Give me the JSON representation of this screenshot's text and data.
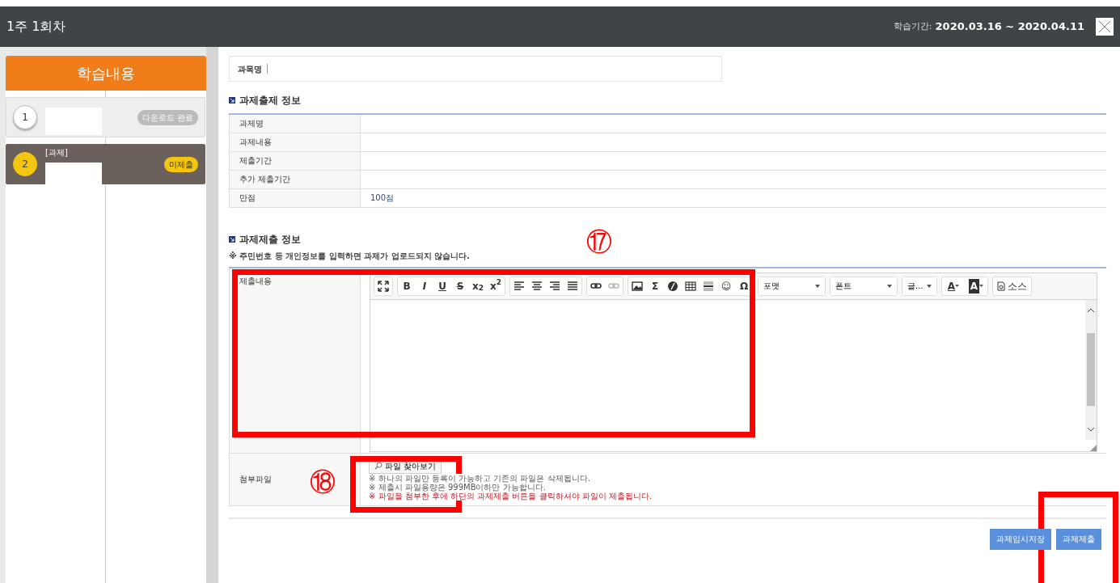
{
  "window": {
    "title": "1주 1회차",
    "period_label": "학습기간:",
    "period": "2020.03.16 ~ 2020.04.11"
  },
  "sidebar": {
    "title": "학습내용",
    "lessons": [
      {
        "number": "1",
        "status": "다운로드 완료",
        "kind": "done",
        "selected": false
      },
      {
        "number": "2",
        "title": "[과제]",
        "status": "미제출",
        "kind": "pending",
        "selected": true
      }
    ]
  },
  "course": {
    "label": "과목명"
  },
  "assignment_info": {
    "heading": "과제출제 정보",
    "rows": [
      {
        "label": "과제명",
        "value": ""
      },
      {
        "label": "과제내용",
        "value": ""
      },
      {
        "label": "제출기간",
        "value": ""
      },
      {
        "label": "추가 제출기간",
        "value": ""
      },
      {
        "label": "만점",
        "value": "100점"
      }
    ]
  },
  "submission": {
    "heading": "과제제출 정보",
    "note": "※ 주민번호 등 개인정보를 입력하면 과제가 업로드되지 않습니다.",
    "content_label": "제출내용",
    "toolbar": [
      [
        {
          "kind": "maximize"
        }
      ],
      [
        {
          "kind": "text",
          "label": "**B**"
        },
        {
          "kind": "text",
          "label": "*I*"
        },
        {
          "kind": "underline",
          "label": "U"
        },
        {
          "kind": "strike",
          "label": "S"
        },
        {
          "kind": "text",
          "label": "x$_{2}$"
        },
        {
          "kind": "text",
          "label": "x$^{2}$"
        }
      ],
      [
        {
          "kind": "align-left"
        },
        {
          "kind": "align-center"
        },
        {
          "kind": "align-right"
        },
        {
          "kind": "justify"
        }
      ],
      [
        {
          "kind": "link",
          "disabled": false
        },
        {
          "kind": "link",
          "disabled": true
        }
      ],
      [
        {
          "kind": "image"
        },
        {
          "kind": "text",
          "label": "Σ"
        },
        {
          "kind": "disc"
        },
        {
          "kind": "table"
        },
        {
          "kind": "hline"
        },
        {
          "kind": "text",
          "label": "☺"
        },
        {
          "kind": "text",
          "label": "Ω"
        }
      ],
      [
        {
          "kind": "dropdown",
          "label": "포맷",
          "wide": true
        }
      ],
      [
        {
          "kind": "dropdown",
          "label": "폰트",
          "wide": true
        }
      ],
      [
        {
          "kind": "dropdown",
          "label": "글...",
          "wide": false
        }
      ],
      [
        {
          "kind": "color",
          "label": "A"
        },
        {
          "kind": "bgcolor",
          "label": "A"
        }
      ],
      [
        {
          "kind": "source",
          "label": "소스"
        }
      ]
    ],
    "attach_label": "첨부파일",
    "browse_button": "파일 찾아보기",
    "notes": [
      {
        "text": "※ 하나의 파일만 등록이 가능하고 기존의 파일은 삭제됩니다.",
        "warning": false
      },
      {
        "text": "※ 제출시 파일용량은 999MB이하만 가능합니다.",
        "warning": false
      },
      {
        "text": "※ 파일을 첨부한 후에 하단의 과제제출 버튼을 클릭하셔야 파일이 제출됩니다.",
        "warning": true
      }
    ]
  },
  "buttons": [
    {
      "label": "과제임시저장"
    },
    {
      "label": "과제제출"
    }
  ],
  "annotations": [
    {
      "kind": "numbered",
      "label": "⑰"
    },
    {
      "kind": "numbered",
      "label": "⑱"
    },
    {
      "kind": "box"
    }
  ]
}
